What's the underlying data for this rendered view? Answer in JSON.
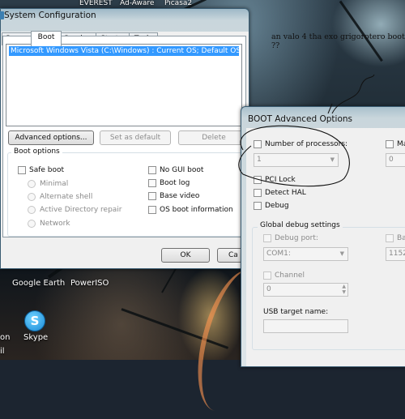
{
  "desktop": {
    "top_labels": [
      "EVEREST",
      "Ad-Aware",
      "Picasa2"
    ],
    "icons": [
      {
        "label": "Google Earth"
      },
      {
        "label": "PowerISO"
      },
      {
        "label": "Skype"
      },
      {
        "label": "on"
      },
      {
        "label": "il"
      }
    ]
  },
  "annotation": "an valo 4 tha exo grigorotero boot ??",
  "sys_config": {
    "title": "System Configuration",
    "tabs": [
      "General",
      "Boot",
      "Services",
      "Startup",
      "Tools"
    ],
    "active_tab": "Boot",
    "os_entry": "Microsoft Windows Vista (C:\\Windows) : Current OS; Default OS",
    "buttons": {
      "advanced": "Advanced options...",
      "set_default": "Set as default",
      "delete": "Delete",
      "ok": "OK",
      "cancel": "Ca"
    },
    "boot_options": {
      "label": "Boot options",
      "safe_boot": "Safe boot",
      "minimal": "Minimal",
      "alternate_shell": "Alternate shell",
      "active_directory_repair": "Active Directory repair",
      "network": "Network",
      "no_gui_boot": "No GUI boot",
      "boot_log": "Boot log",
      "base_video": "Base video",
      "os_boot_information": "OS boot information"
    }
  },
  "advanced": {
    "title": "BOOT Advanced Options",
    "number_of_processors": "Number of processors:",
    "processors_value": "1",
    "maximum_memory_partial": "Ma",
    "memory_value": "0",
    "pci_lock": "PCI Lock",
    "detect_hal": "Detect HAL",
    "debug": "Debug",
    "global_debug": "Global debug settings",
    "debug_port": "Debug port:",
    "debug_port_value": "COM1:",
    "baud_partial": "Ba",
    "baud_value": "1152",
    "channel": "Channel",
    "channel_value": "0",
    "usb_target_name": "USB target name:",
    "usb_target_value": ""
  }
}
